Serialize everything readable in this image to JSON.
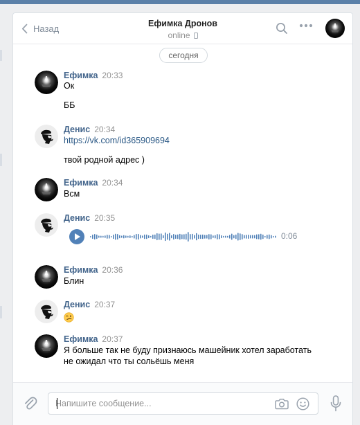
{
  "header": {
    "back_label": "Назад",
    "title": "Ефимка Дронов",
    "status": "online"
  },
  "history": {
    "date_label": "сегодня",
    "messages": [
      {
        "author": "Ефимка",
        "time": "20:33",
        "lines": [
          "Ок",
          "ББ"
        ]
      },
      {
        "author": "Денис",
        "time": "20:34",
        "link": "https://vk.com/id365909694",
        "lines": [
          "твой родной адрес )"
        ]
      },
      {
        "author": "Ефимка",
        "time": "20:34",
        "lines": [
          "Всм"
        ]
      },
      {
        "author": "Денис",
        "time": "20:35",
        "voice": {
          "duration": "0:06"
        }
      },
      {
        "author": "Ефимка",
        "time": "20:36",
        "lines": [
          "Блин"
        ]
      },
      {
        "author": "Денис",
        "time": "20:37",
        "emoji": "winking-face"
      },
      {
        "author": "Ефимка",
        "time": "20:37",
        "lines": [
          "Я больше так не буду признаюсь машейник хотел заработать",
          "не ожидал что ты сольёшь меня"
        ]
      }
    ]
  },
  "composer": {
    "placeholder": "Напишите сообщение..."
  },
  "colors": {
    "accent": "#5181b8",
    "name": "#42648b",
    "link": "#2a5885",
    "muted": "#939393",
    "top_strip": "#5b80a8"
  },
  "icons": [
    "chevron-left-icon",
    "search-icon",
    "more-icon",
    "phone-icon",
    "play-icon",
    "paperclip-icon",
    "camera-icon",
    "smile-icon",
    "microphone-icon"
  ]
}
